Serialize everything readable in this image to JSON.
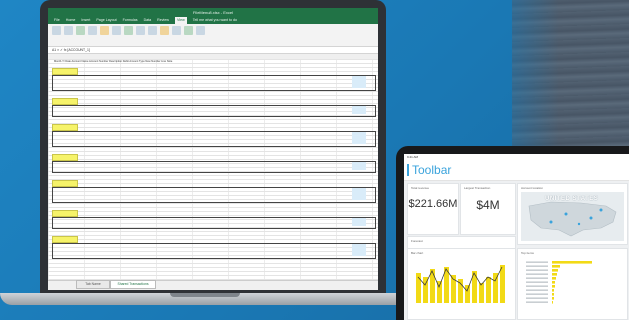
{
  "laptop": {
    "excel": {
      "window_title": "FileMenu8.xlsx - Excel",
      "menu_tabs": [
        "File",
        "Home",
        "Insert",
        "Page Layout",
        "Formulas",
        "Data",
        "Review",
        "View",
        "Tell me what you want to do"
      ],
      "active_tab_index": 7,
      "formula_bar": "A1   ×  ✓  fx   [ACCOUNT_1]",
      "column_headers": [
        "Month-Yr",
        "Date",
        "Account Name",
        "Account Number",
        "Description",
        "",
        "",
        "",
        "Debit Amount",
        "Type",
        "New Number",
        "Line Note"
      ],
      "groups": [
        "2/28/2016 - A01",
        "2/28/2016 - A02",
        "2/28/2016 - A03",
        "2/28/2016 - A04",
        "2/28/2016 - A05",
        "2/28/2016 - A06",
        "2/28/2016 - A07"
      ],
      "sheet_tabs": [
        "Tab Name",
        "Shared Transactions"
      ],
      "accent": "#217346"
    }
  },
  "tablet": {
    "status_left": "9:41 AM",
    "app_title": "Toolbar",
    "cards": {
      "total_revenue_label": "Total revenue",
      "total_revenue_value": "$221.66M",
      "largest_label": "Largest Transaction",
      "largest_value": "$4M",
      "map_label": "Account location",
      "map_country": "UNITED STATES",
      "trend_label": "Forecast",
      "bar_label": "Bar chart",
      "hbar_label": "Top items"
    },
    "accent": "#3aa3dc",
    "bar_color": "#f2da16"
  }
}
